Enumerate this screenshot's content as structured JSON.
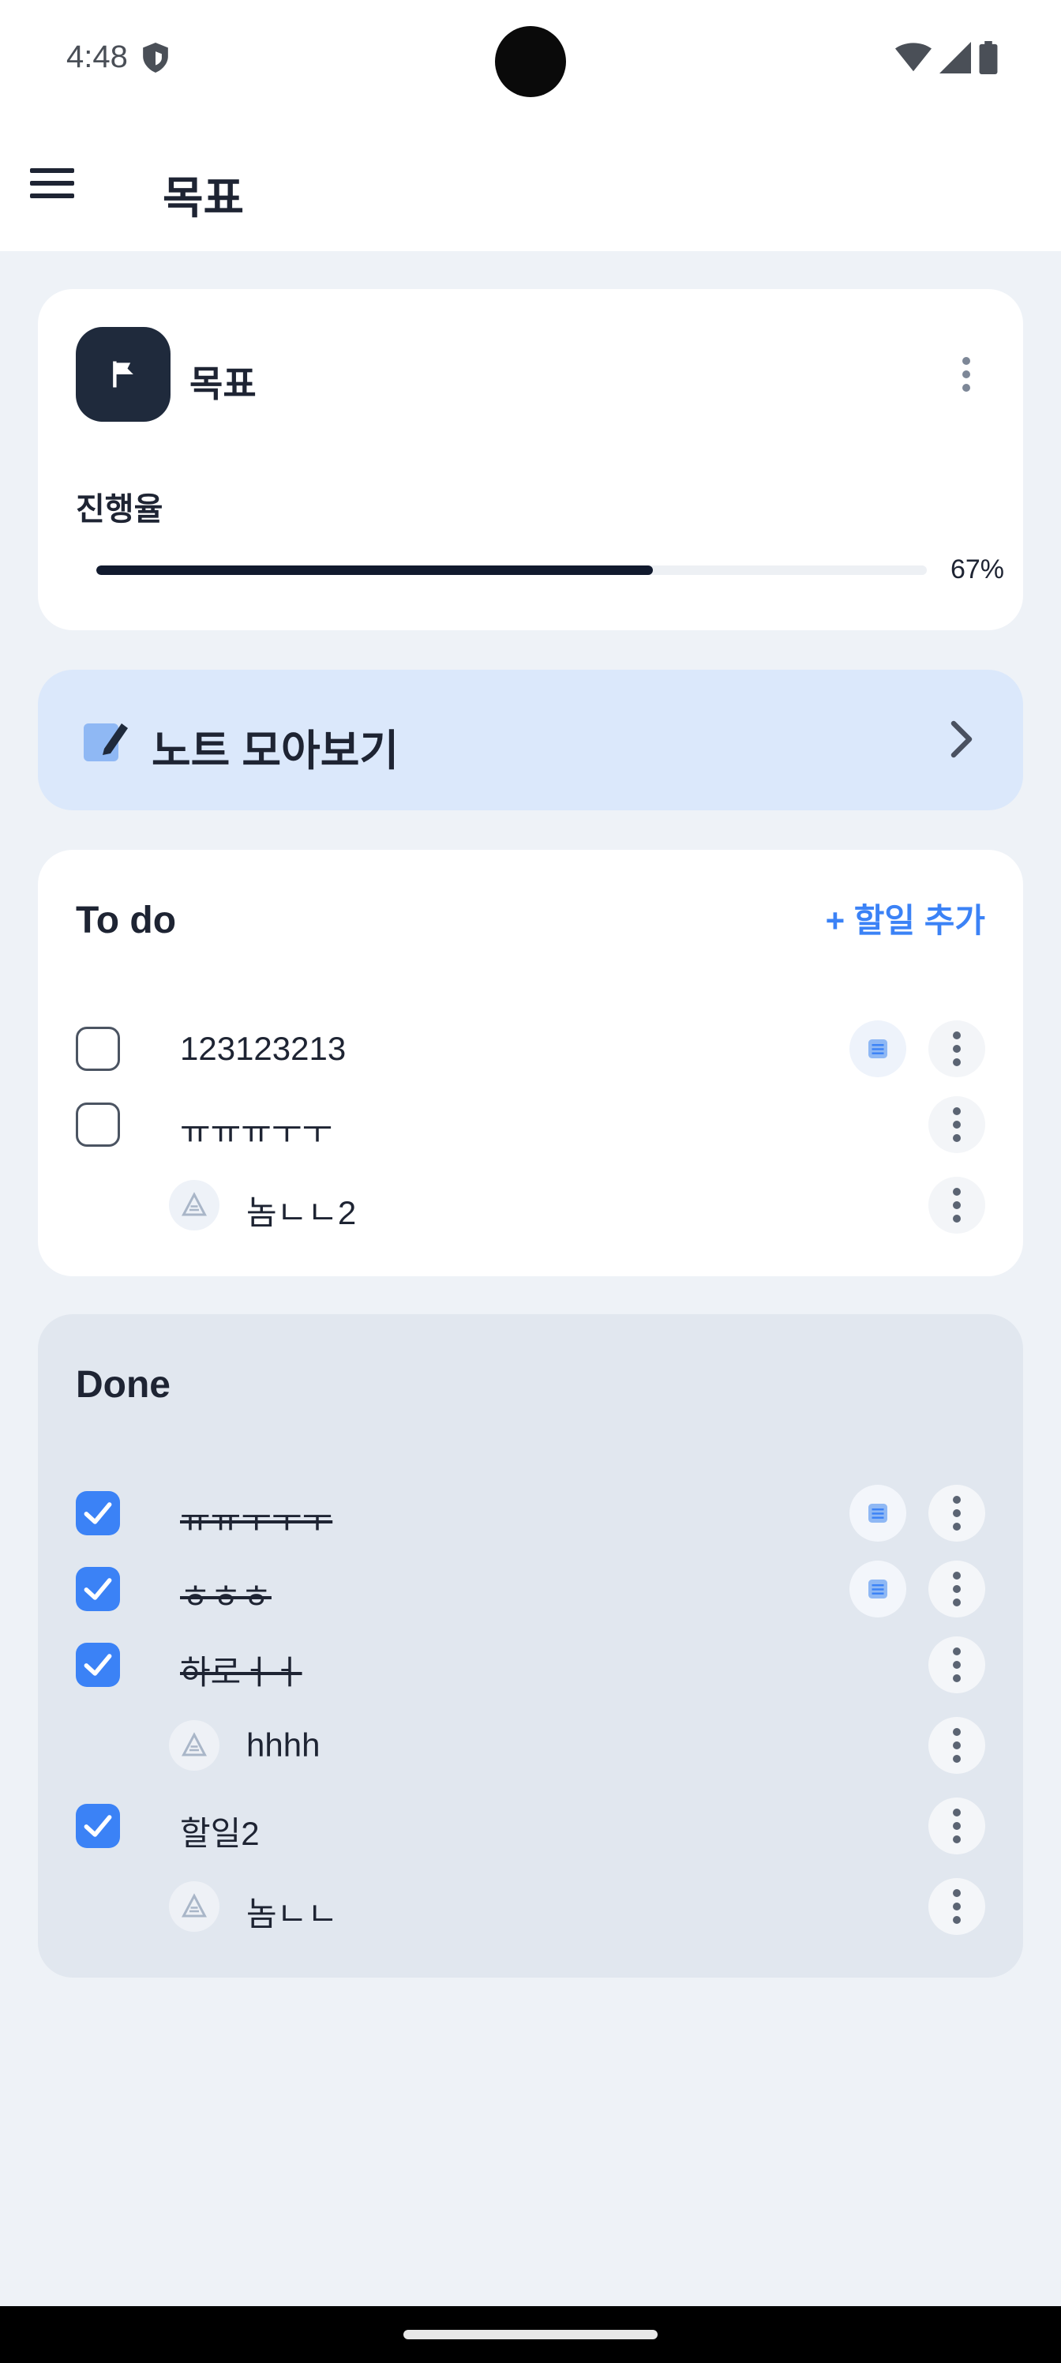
{
  "status": {
    "time": "4:48"
  },
  "appbar": {
    "title": "목표"
  },
  "goal": {
    "name": "목표",
    "progress_label": "진행율",
    "progress_value": "67%",
    "progress_fraction": 0.67
  },
  "notes": {
    "label": "노트 모아보기"
  },
  "todo": {
    "title": "To do",
    "add_label": "+ 할일 추가",
    "items": [
      {
        "text": "123123213"
      },
      {
        "text": "ㅠㅠㅠㅜㅜ"
      },
      {
        "text": "놈ㄴㄴ2"
      }
    ]
  },
  "done": {
    "title": "Done",
    "items": [
      {
        "text": "ㅠㅠㅜㅜㅜ"
      },
      {
        "text": "ㅎㅎㅎ"
      },
      {
        "text": "하로ㅓㅓ"
      },
      {
        "text": "hhhh"
      },
      {
        "text": "할일2"
      },
      {
        "text": "놈ㄴㄴ"
      }
    ]
  },
  "colors": {
    "accent": "#3b82f6",
    "dark": "#1f2a3c",
    "notes_bg": "#dbe8fb"
  }
}
